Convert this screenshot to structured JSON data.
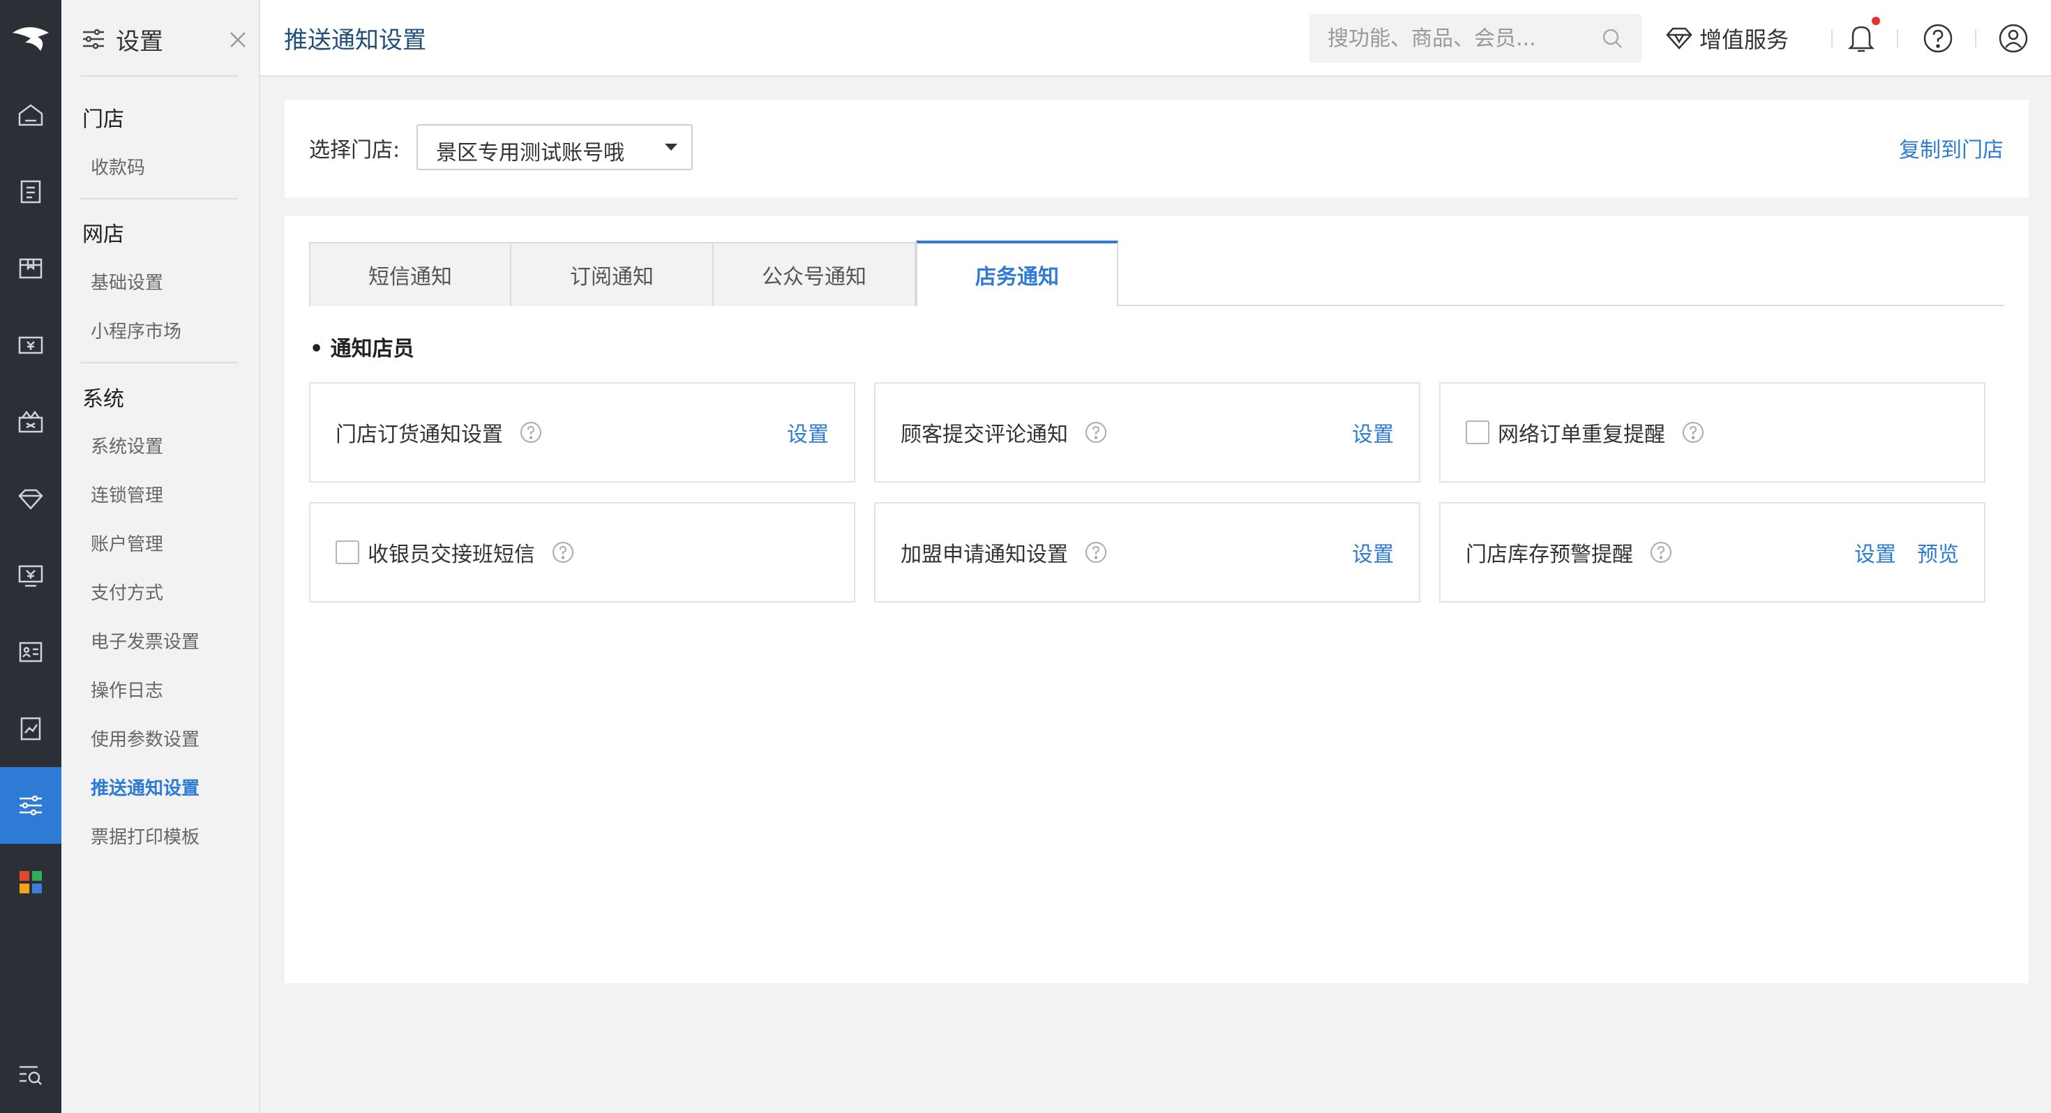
{
  "sidebar": {
    "title": "设置",
    "groups": [
      {
        "label": "门店",
        "items": [
          "收款码"
        ]
      },
      {
        "label": "网店",
        "items": [
          "基础设置",
          "小程序市场"
        ]
      },
      {
        "label": "系统",
        "items": [
          "系统设置",
          "连锁管理",
          "账户管理",
          "支付方式",
          "电子发票设置",
          "操作日志",
          "使用参数设置",
          "推送通知设置",
          "票据打印模板"
        ]
      }
    ],
    "active_item": "推送通知设置"
  },
  "header": {
    "title": "推送通知设置",
    "search_placeholder": "搜功能、商品、会员...",
    "value_added_label": "增值服务"
  },
  "store": {
    "label": "选择门店:",
    "selected": "景区专用测试账号哦",
    "copy_label": "复制到门店"
  },
  "tabs": [
    {
      "label": "短信通知",
      "active": false
    },
    {
      "label": "订阅通知",
      "active": false
    },
    {
      "label": "公众号通知",
      "active": false
    },
    {
      "label": "店务通知",
      "active": true
    }
  ],
  "section": {
    "title": "• 通知店员"
  },
  "cards": [
    {
      "label": "门店订货通知设置",
      "checkbox": false,
      "links": [
        "设置"
      ]
    },
    {
      "label": "顾客提交评论通知",
      "checkbox": false,
      "links": [
        "设置"
      ]
    },
    {
      "label": "网络订单重复提醒",
      "checkbox": true,
      "checked": false,
      "links": []
    },
    {
      "label": "收银员交接班短信",
      "checkbox": true,
      "checked": false,
      "links": []
    },
    {
      "label": "加盟申请通知设置",
      "checkbox": false,
      "links": [
        "设置"
      ]
    },
    {
      "label": "门店库存预警提醒",
      "checkbox": false,
      "links": [
        "设置",
        "预览"
      ]
    }
  ],
  "colors": {
    "accent": "#2d7bd4",
    "rail": "#2b2f36",
    "alert": "#e03030"
  }
}
